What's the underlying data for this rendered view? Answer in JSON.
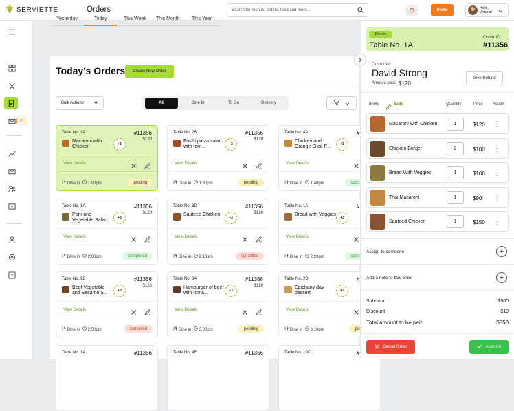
{
  "app": {
    "brand": "SERVIETTE",
    "page_title": "Orders"
  },
  "topbar": {
    "search_placeholder": "Search for menus, orders, food and more...",
    "invite_label": "Invite",
    "user_greeting": "Hello,",
    "user_name": "Victoria!"
  },
  "sidebar": {
    "notification_count": "10"
  },
  "date_tabs": [
    "Yesterday",
    "Today",
    "This Week",
    "This Month",
    "This Year"
  ],
  "orders": {
    "title": "Today's Orders",
    "create_label": "Create New Order",
    "bulk_label": "Bulk Actions",
    "segments": [
      "All",
      "Dine In",
      "To Go",
      "Delivery"
    ],
    "view_label": "View Details",
    "mode_label": "Dine in",
    "cards": [
      {
        "table": "Table No. 1A",
        "id": "#11356",
        "price": "$120",
        "dish": "Macaroni with Chicken",
        "more": "+3",
        "time": "1:00pm",
        "status": "pending",
        "selected": true,
        "thumb": "#b8702e"
      },
      {
        "table": "Table No. 2B",
        "id": "#11356",
        "price": "$120",
        "dish": "Fusilli pasta salad with tom...",
        "more": "+3",
        "time": "1:30pm",
        "status": "pending",
        "selected": false,
        "thumb": "#a04a2a"
      },
      {
        "table": "Table No. 4A",
        "id": "#11356",
        "price": "$120",
        "dish": "Chicken and Orange Slice P...",
        "more": "+3",
        "time": "1:48pm",
        "status": "completed",
        "selected": false,
        "thumb": "#c78a3a"
      },
      {
        "table": "Table No. 1A",
        "id": "#11356",
        "price": "$120",
        "dish": "Pork and Vegetable Salad",
        "more": "+3",
        "time": "2:00pm",
        "status": "completed",
        "selected": false,
        "thumb": "#7a6a3a"
      },
      {
        "table": "Table No. 8D",
        "id": "#11356",
        "price": "$120",
        "dish": "Sauteed Chicken",
        "more": "+3",
        "time": "2:10am",
        "status": "cancelled",
        "selected": false,
        "thumb": "#8a4f2c"
      },
      {
        "table": "Table No. 1A",
        "id": "#11356",
        "price": "$120",
        "dish": "Bread with Veggies",
        "more": "+3",
        "time": "2:20pm",
        "status": "completed",
        "selected": false,
        "thumb": "#9b6b3f"
      },
      {
        "table": "Table No. 9B",
        "id": "#11356",
        "price": "$120",
        "dish": "Beef Vegetable and Sesame S...",
        "more": "+3",
        "time": "2:50pm",
        "status": "cancelled",
        "selected": false,
        "thumb": "#6e4426"
      },
      {
        "table": "Table No. 8A",
        "id": "#11356",
        "price": "$120",
        "dish": "Hamburger of beef with toma...",
        "more": "+3",
        "time": "3:00pm",
        "status": "pending",
        "selected": false,
        "thumb": "#5d4030"
      },
      {
        "table": "Table No. 2D",
        "id": "#11356",
        "price": "$120",
        "dish": "Epiphany day dessert",
        "more": "+3",
        "time": "3:10pm",
        "status": "pending",
        "selected": false,
        "thumb": "#c89a5a"
      },
      {
        "table": "Table No. 1A",
        "id": "#11356",
        "price": "",
        "dish": "",
        "more": "",
        "time": "",
        "status": "",
        "selected": false,
        "thumb": ""
      },
      {
        "table": "Table No. 4F",
        "id": "#11356",
        "price": "",
        "dish": "",
        "more": "",
        "time": "",
        "status": "",
        "selected": false,
        "thumb": ""
      },
      {
        "table": "Table No. 10C",
        "id": "#11356",
        "price": "",
        "dish": "",
        "more": "",
        "time": "",
        "status": "",
        "selected": false,
        "thumb": ""
      }
    ]
  },
  "detail": {
    "dine_pill": "Dine in",
    "table": "Table No. 1A",
    "order_label": "Order ID",
    "order_id": "#11356",
    "customer_label": "Customer",
    "customer_name": "David Strong",
    "paid_label": "Amount paid:",
    "paid_value": "$120",
    "refund_label": "Give Refund",
    "headers": {
      "items": "Items",
      "edit": "Edit",
      "quantity": "Quantity",
      "price": "Price",
      "action": "Action"
    },
    "items": [
      {
        "name": "Macaroni with Chicken",
        "qty": "1",
        "price": "$120",
        "img": "#b5692c"
      },
      {
        "name": "Chicken Burger",
        "qty": "2",
        "price": "$100",
        "img": "#6b4a2e"
      },
      {
        "name": "Bread With Veggies",
        "qty": "1",
        "price": "$100",
        "img": "#8d7a3e"
      },
      {
        "name": "Thai Macaroni",
        "qty": "1",
        "price": "$90",
        "img": "#c58744"
      },
      {
        "name": "Sauteed Chicken",
        "qty": "1",
        "price": "$150",
        "img": "#8a5230"
      }
    ],
    "assign_label": "Assign to someone",
    "note_label": "Add a note to this order",
    "subtotal_label": "Sub-total",
    "subtotal": "$560",
    "discount_label": "Discount",
    "discount": "$10",
    "total_label": "Total amount to be paid",
    "total": "$550",
    "cancel_label": "Cancel Order",
    "approve_label": "Approve"
  }
}
